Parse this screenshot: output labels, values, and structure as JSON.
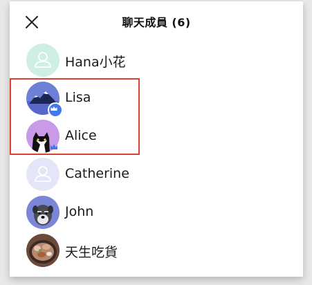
{
  "header": {
    "title": "聊天成員 (6)",
    "close_icon": "close-icon"
  },
  "members": [
    {
      "name": "Hana小花",
      "avatar": "default-person-avatar",
      "avatar_color": "#cfeee5",
      "role": ""
    },
    {
      "name": "Lisa",
      "avatar": "mountain-avatar",
      "avatar_color": "#6e7fd6",
      "role": "admin-crown"
    },
    {
      "name": "Alice",
      "avatar": "cat-avatar",
      "avatar_color": "#c89ae8",
      "role": "admin-crown"
    },
    {
      "name": "Catherine",
      "avatar": "default-person-avatar",
      "avatar_color": "#e4e6f8",
      "role": ""
    },
    {
      "name": "John",
      "avatar": "dog-avatar",
      "avatar_color": "#7c86d8",
      "role": ""
    },
    {
      "name": "天生吃貨",
      "avatar": "food-photo-avatar",
      "avatar_color": "#6b4a3a",
      "role": ""
    }
  ],
  "colors": {
    "highlight": "#d9432d",
    "crown_badge": "#3f7be8"
  }
}
